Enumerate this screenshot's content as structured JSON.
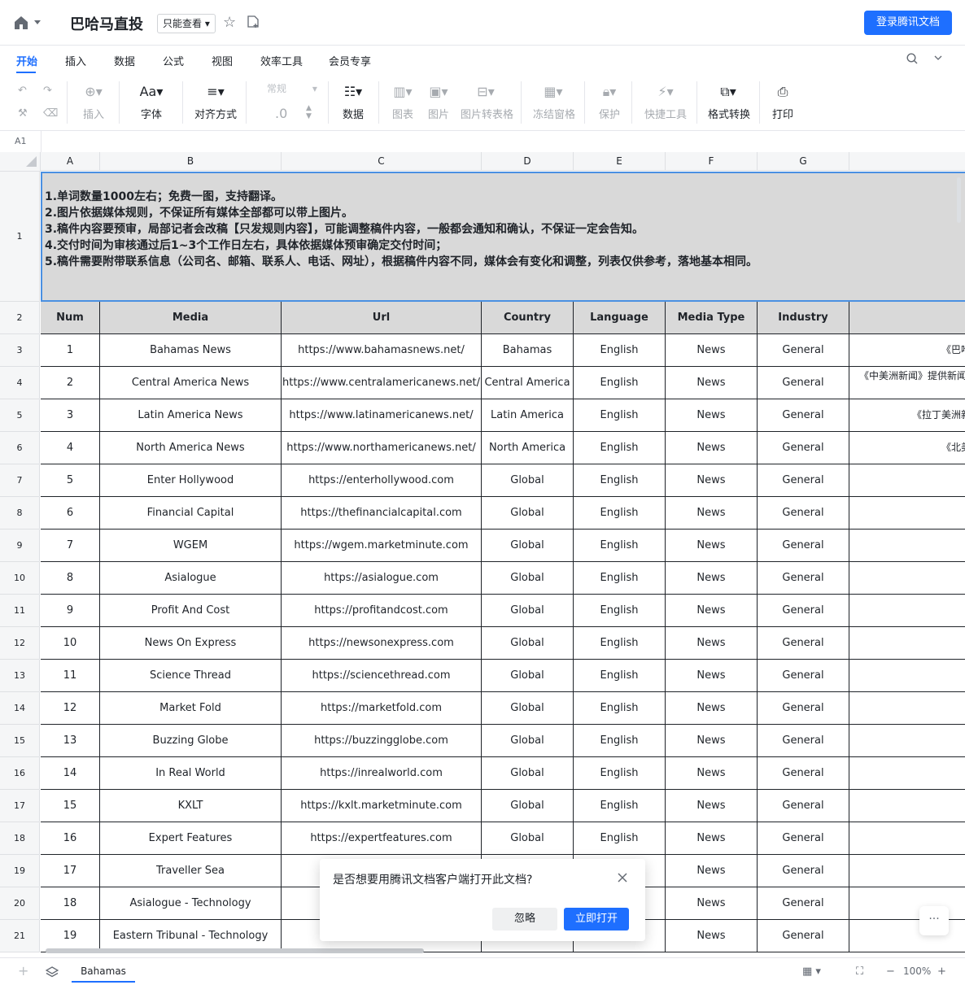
{
  "doc": {
    "title": "巴哈马直投",
    "mode": "只能查看",
    "login_label": "登录腾讯文档"
  },
  "tabs": [
    "开始",
    "插入",
    "数据",
    "公式",
    "视图",
    "效率工具",
    "会员专享"
  ],
  "toolbar": {
    "insert": "插入",
    "font": "字体",
    "align": "对齐方式",
    "number_format": "常规",
    "decimal": ".0",
    "data": "数据",
    "chart": "图表",
    "image": "图片",
    "image_to_table": "图片转表格",
    "freeze": "冻结窗格",
    "protect": "保护",
    "quick_tools": "快捷工具",
    "format_convert": "格式转换",
    "print": "打印"
  },
  "formula_bar": {
    "cell_ref": "A1"
  },
  "grid": {
    "columns": [
      "A",
      "B",
      "C",
      "D",
      "E",
      "F",
      "G"
    ],
    "row_numbers": [
      "1",
      "2",
      "3",
      "4",
      "5",
      "6",
      "7",
      "8",
      "9",
      "10",
      "11",
      "12",
      "13",
      "14",
      "15",
      "16",
      "17",
      "18",
      "19",
      "20",
      "21"
    ],
    "notes": [
      "1.单词数量1000左右；免费一图，支持翻译。",
      "2.图片依据媒体规则，不保证所有媒体全部都可以带上图片。",
      "3.稿件内容要预审，局部记者会改稿【只发规则内容】，可能调整稿件内容，一般都会通知和确认，不保证一定会告知。",
      "4.交付时间为审核通过后1~3个工作日左右，具体依据媒体预审确定交付时间；",
      "5.稿件需要附带联系信息（公司名、邮箱、联系人、电话、网址），根据稿件内容不同，媒体会有变化和调整，列表仅供参考，落地基本相同。"
    ],
    "headers": [
      "Num",
      "Media",
      "Url",
      "Country",
      "Language",
      "Media Type",
      "Industry"
    ],
    "rows": [
      [
        "1",
        "Bahamas News",
        "https://www.bahamasnews.net/",
        "Bahamas",
        "English",
        "News",
        "General",
        "《巴哈"
      ],
      [
        "2",
        "Central America News",
        "https://www.centralamericanews.net/",
        "Central America",
        "English",
        "News",
        "General",
        "《中美洲新闻》提供新闻"
      ],
      [
        "3",
        "Latin America News",
        "https://www.latinamericanews.net/",
        "Latin America",
        "English",
        "News",
        "General",
        "《拉丁美洲新"
      ],
      [
        "4",
        "North America News",
        "https://www.northamericanews.net/",
        "North America",
        "English",
        "News",
        "General",
        "《北美"
      ],
      [
        "5",
        "Enter Hollywood",
        "https://enterhollywood.com",
        "Global",
        "English",
        "News",
        "General",
        ""
      ],
      [
        "6",
        "Financial Capital",
        "https://thefinancialcapital.com",
        "Global",
        "English",
        "News",
        "General",
        ""
      ],
      [
        "7",
        "WGEM",
        "https://wgem.marketminute.com",
        "Global",
        "English",
        "News",
        "General",
        ""
      ],
      [
        "8",
        "Asialogue",
        "https://asialogue.com",
        "Global",
        "English",
        "News",
        "General",
        ""
      ],
      [
        "9",
        "Profit And Cost",
        "https://profitandcost.com",
        "Global",
        "English",
        "News",
        "General",
        ""
      ],
      [
        "10",
        "News On Express",
        "https://newsonexpress.com",
        "Global",
        "English",
        "News",
        "General",
        ""
      ],
      [
        "11",
        "Science Thread",
        "https://sciencethread.com",
        "Global",
        "English",
        "News",
        "General",
        ""
      ],
      [
        "12",
        "Market Fold",
        "https://marketfold.com",
        "Global",
        "English",
        "News",
        "General",
        ""
      ],
      [
        "13",
        "Buzzing Globe",
        "https://buzzingglobe.com",
        "Global",
        "English",
        "News",
        "General",
        ""
      ],
      [
        "14",
        "In Real World",
        "https://inrealworld.com",
        "Global",
        "English",
        "News",
        "General",
        ""
      ],
      [
        "15",
        "KXLT",
        "https://kxlt.marketminute.com",
        "Global",
        "English",
        "News",
        "General",
        ""
      ],
      [
        "16",
        "Expert Features",
        "https://expertfeatures.com",
        "Global",
        "English",
        "News",
        "General",
        ""
      ],
      [
        "17",
        "Traveller Sea",
        "",
        "",
        "",
        "News",
        "General",
        ""
      ],
      [
        "18",
        "Asialogue - Technology",
        "",
        "",
        "",
        "News",
        "General",
        ""
      ],
      [
        "19",
        "Eastern Tribunal - Technology",
        "htt",
        "",
        "",
        "News",
        "General",
        ""
      ]
    ]
  },
  "dialog": {
    "message": "是否想要用腾讯文档客户端打开此文档?",
    "ignore_label": "忽略",
    "open_label": "立即打开"
  },
  "more_label": "···",
  "bottom": {
    "sheet_tab": "Bahamas",
    "zoom": "100%"
  }
}
